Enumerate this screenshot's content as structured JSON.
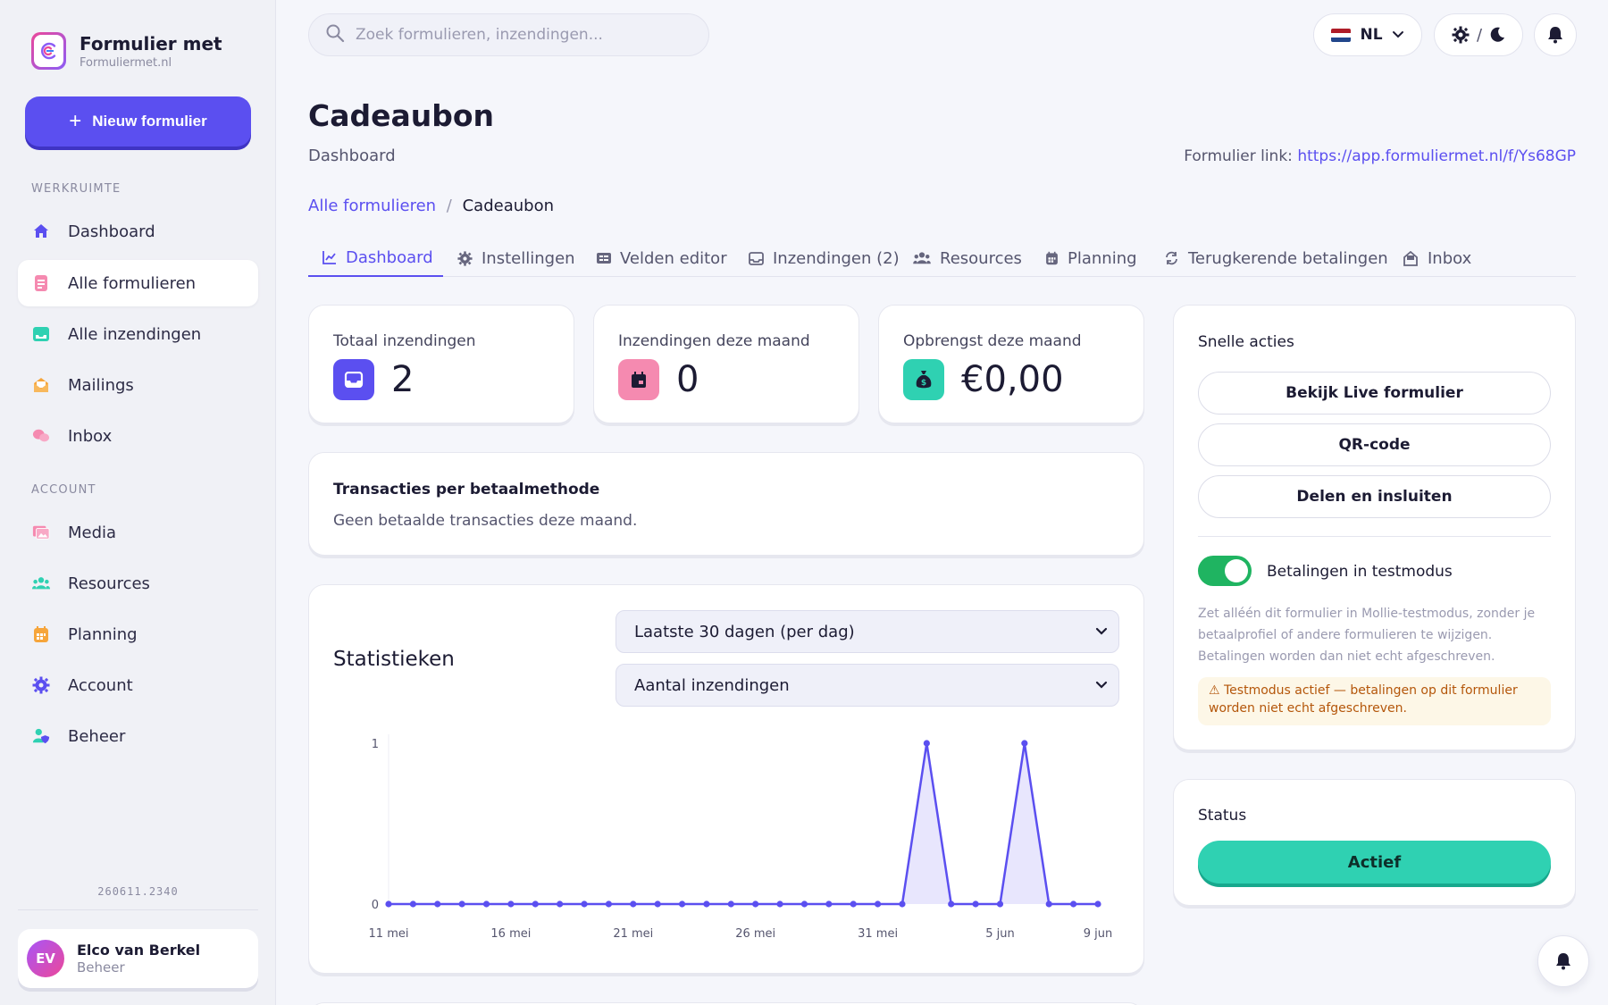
{
  "brand": {
    "title": "Formulier met",
    "subtitle": "Formuliermet.nl"
  },
  "sidebar": {
    "new_form_label": "Nieuw formulier",
    "workspace_heading": "WERKRUIMTE",
    "account_heading": "ACCOUNT",
    "workspace_items": [
      {
        "label": "Dashboard",
        "icon": "home-icon"
      },
      {
        "label": "Alle formulieren",
        "icon": "form-icon",
        "active": true
      },
      {
        "label": "Alle inzendingen",
        "icon": "inbox-icon"
      },
      {
        "label": "Mailings",
        "icon": "mail-icon"
      },
      {
        "label": "Inbox",
        "icon": "chat-icon"
      }
    ],
    "account_items": [
      {
        "label": "Media",
        "icon": "media-icon"
      },
      {
        "label": "Resources",
        "icon": "users-icon"
      },
      {
        "label": "Planning",
        "icon": "calendar-icon"
      },
      {
        "label": "Account",
        "icon": "gear-icon"
      },
      {
        "label": "Beheer",
        "icon": "user-shield-icon"
      }
    ],
    "version": "260611.2340",
    "user": {
      "initials": "EV",
      "name": "Elco van Berkel",
      "role": "Beheer"
    }
  },
  "topbar": {
    "search_placeholder": "Zoek formulieren, inzendingen...",
    "language": "NL",
    "theme_separator": "/"
  },
  "header": {
    "title": "Cadeaubon",
    "subtitle": "Dashboard",
    "form_link_label": "Formulier link:",
    "form_link_url": "https://app.formuliermet.nl/f/Ys68GP",
    "breadcrumb_root": "Alle formulieren",
    "breadcrumb_sep": "/",
    "breadcrumb_current": "Cadeaubon"
  },
  "tabs": [
    {
      "label": "Dashboard",
      "icon": "chart-icon",
      "active": true
    },
    {
      "label": "Instellingen",
      "icon": "gear-icon"
    },
    {
      "label": "Velden editor",
      "icon": "fields-icon"
    },
    {
      "label": "Inzendingen (2)",
      "icon": "inbox-icon"
    },
    {
      "label": "Resources",
      "icon": "users-icon"
    },
    {
      "label": "Planning",
      "icon": "calendar-icon"
    },
    {
      "label": "Terugkerende betalingen",
      "icon": "repeat-icon"
    },
    {
      "label": "Inbox",
      "icon": "mailbox-icon"
    }
  ],
  "stats": [
    {
      "label": "Totaal inzendingen",
      "value": "2",
      "icon": "inbox-icon",
      "color": "#5b4ff0"
    },
    {
      "label": "Inzendingen deze maand",
      "value": "0",
      "icon": "calendar-icon",
      "color": "#f58ab0"
    },
    {
      "label": "Opbrengst deze maand",
      "value": "€0,00",
      "icon": "money-bag-icon",
      "color": "#2fd1b2"
    }
  ],
  "transactions": {
    "title": "Transacties per betaalmethode",
    "empty_text": "Geen betaalde transacties deze maand."
  },
  "statistics": {
    "title": "Statistieken",
    "range_select": "Laatste 30 dagen (per dag)",
    "metric_select": "Aantal inzendingen"
  },
  "chart_data": {
    "type": "area",
    "title": "",
    "xlabel": "",
    "ylabel": "",
    "x": [
      "11 mei",
      "12 mei",
      "13 mei",
      "14 mei",
      "15 mei",
      "16 mei",
      "17 mei",
      "18 mei",
      "19 mei",
      "20 mei",
      "21 mei",
      "22 mei",
      "23 mei",
      "24 mei",
      "25 mei",
      "26 mei",
      "27 mei",
      "28 mei",
      "29 mei",
      "30 mei",
      "31 mei",
      "1 jun",
      "2 jun",
      "3 jun",
      "4 jun",
      "5 jun",
      "6 jun",
      "7 jun",
      "8 jun",
      "9 jun"
    ],
    "values": [
      0,
      0,
      0,
      0,
      0,
      0,
      0,
      0,
      0,
      0,
      0,
      0,
      0,
      0,
      0,
      0,
      0,
      0,
      0,
      0,
      0,
      0,
      1,
      0,
      0,
      0,
      1,
      0,
      0,
      0
    ],
    "x_tick_labels": [
      "11 mei",
      "16 mei",
      "21 mei",
      "26 mei",
      "31 mei",
      "5 jun",
      "9 jun"
    ],
    "y_tick_labels": [
      "0",
      "1"
    ],
    "ylim": [
      0,
      1
    ],
    "grid": false,
    "color": "#5b4ff0"
  },
  "quick_actions": {
    "title": "Snelle acties",
    "buttons": [
      "Bekijk Live formulier",
      "QR-code",
      "Delen en insluiten"
    ],
    "test_mode_label": "Betalingen in testmodus",
    "test_mode_on": true,
    "test_mode_help": "Zet alléén dit formulier in Mollie-testmodus, zonder je betaalprofiel of andere formulieren te wijzigen. Betalingen worden dan niet echt afgeschreven.",
    "warning": "⚠ Testmodus actief — betalingen op dit formulier worden niet echt afgeschreven."
  },
  "status": {
    "title": "Status",
    "button": "Actief"
  }
}
